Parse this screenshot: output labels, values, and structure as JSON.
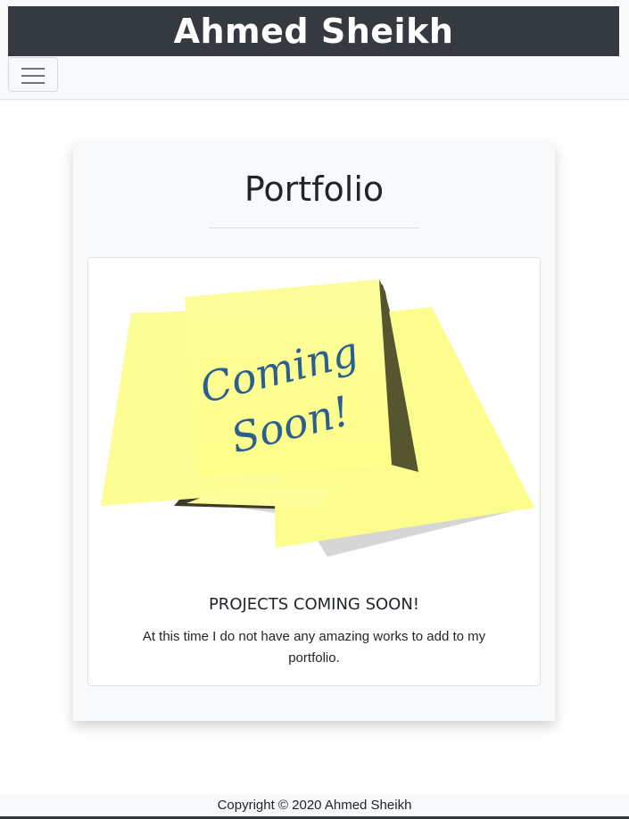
{
  "header": {
    "brand": "Ahmed Sheikh",
    "menu_icon": "hamburger-menu-icon"
  },
  "portfolio": {
    "title": "Portfolio",
    "card": {
      "image_text": [
        "Coming",
        "Soon!"
      ],
      "title": "PROJECTS COMING SOON!",
      "text": "At this time I do not have any amazing works to add to my portfolio."
    }
  },
  "footer": {
    "copyright": "Copyright © 2020 Ahmed Sheikh"
  },
  "colors": {
    "brand_bg": "#343a40",
    "sticky_note": "#ffff99",
    "handwriting": "#2b5f8f",
    "light_bg": "#f8f9fa"
  }
}
